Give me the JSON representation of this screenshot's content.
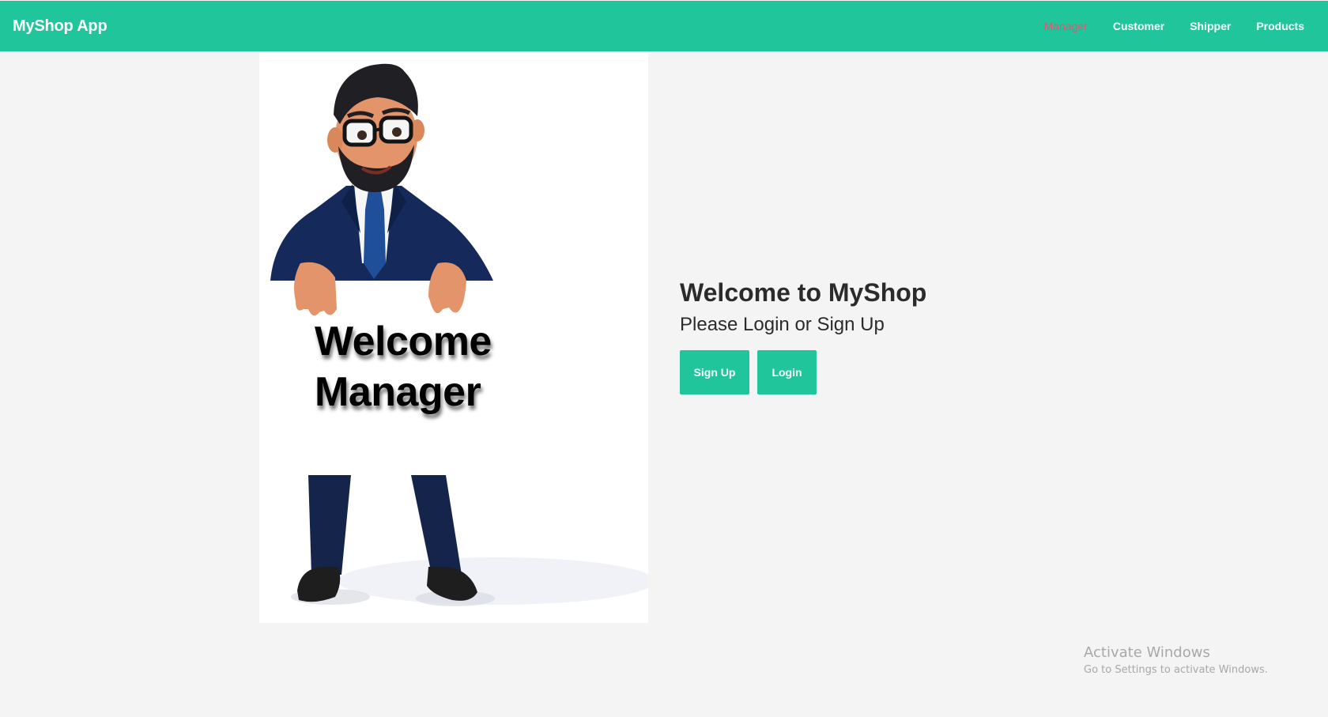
{
  "navbar": {
    "brand": "MyShop App",
    "links": [
      {
        "label": "Manager",
        "active": true
      },
      {
        "label": "Customer",
        "active": false
      },
      {
        "label": "Shipper",
        "active": false
      },
      {
        "label": "Products",
        "active": false
      }
    ]
  },
  "hero": {
    "illustration": "cartoon-businessman-holding-sign",
    "sign_line1": "Welcome",
    "sign_line2": "Manager"
  },
  "welcome": {
    "title": "Welcome to MyShop",
    "subtitle": "Please Login or Sign Up",
    "signup_label": "Sign Up",
    "login_label": "Login"
  },
  "watermark": {
    "title": "Activate Windows",
    "subtitle": "Go to Settings to activate Windows."
  },
  "colors": {
    "accent": "#21c59b",
    "active_link": "#e0566f",
    "background": "#f4f4f4"
  }
}
